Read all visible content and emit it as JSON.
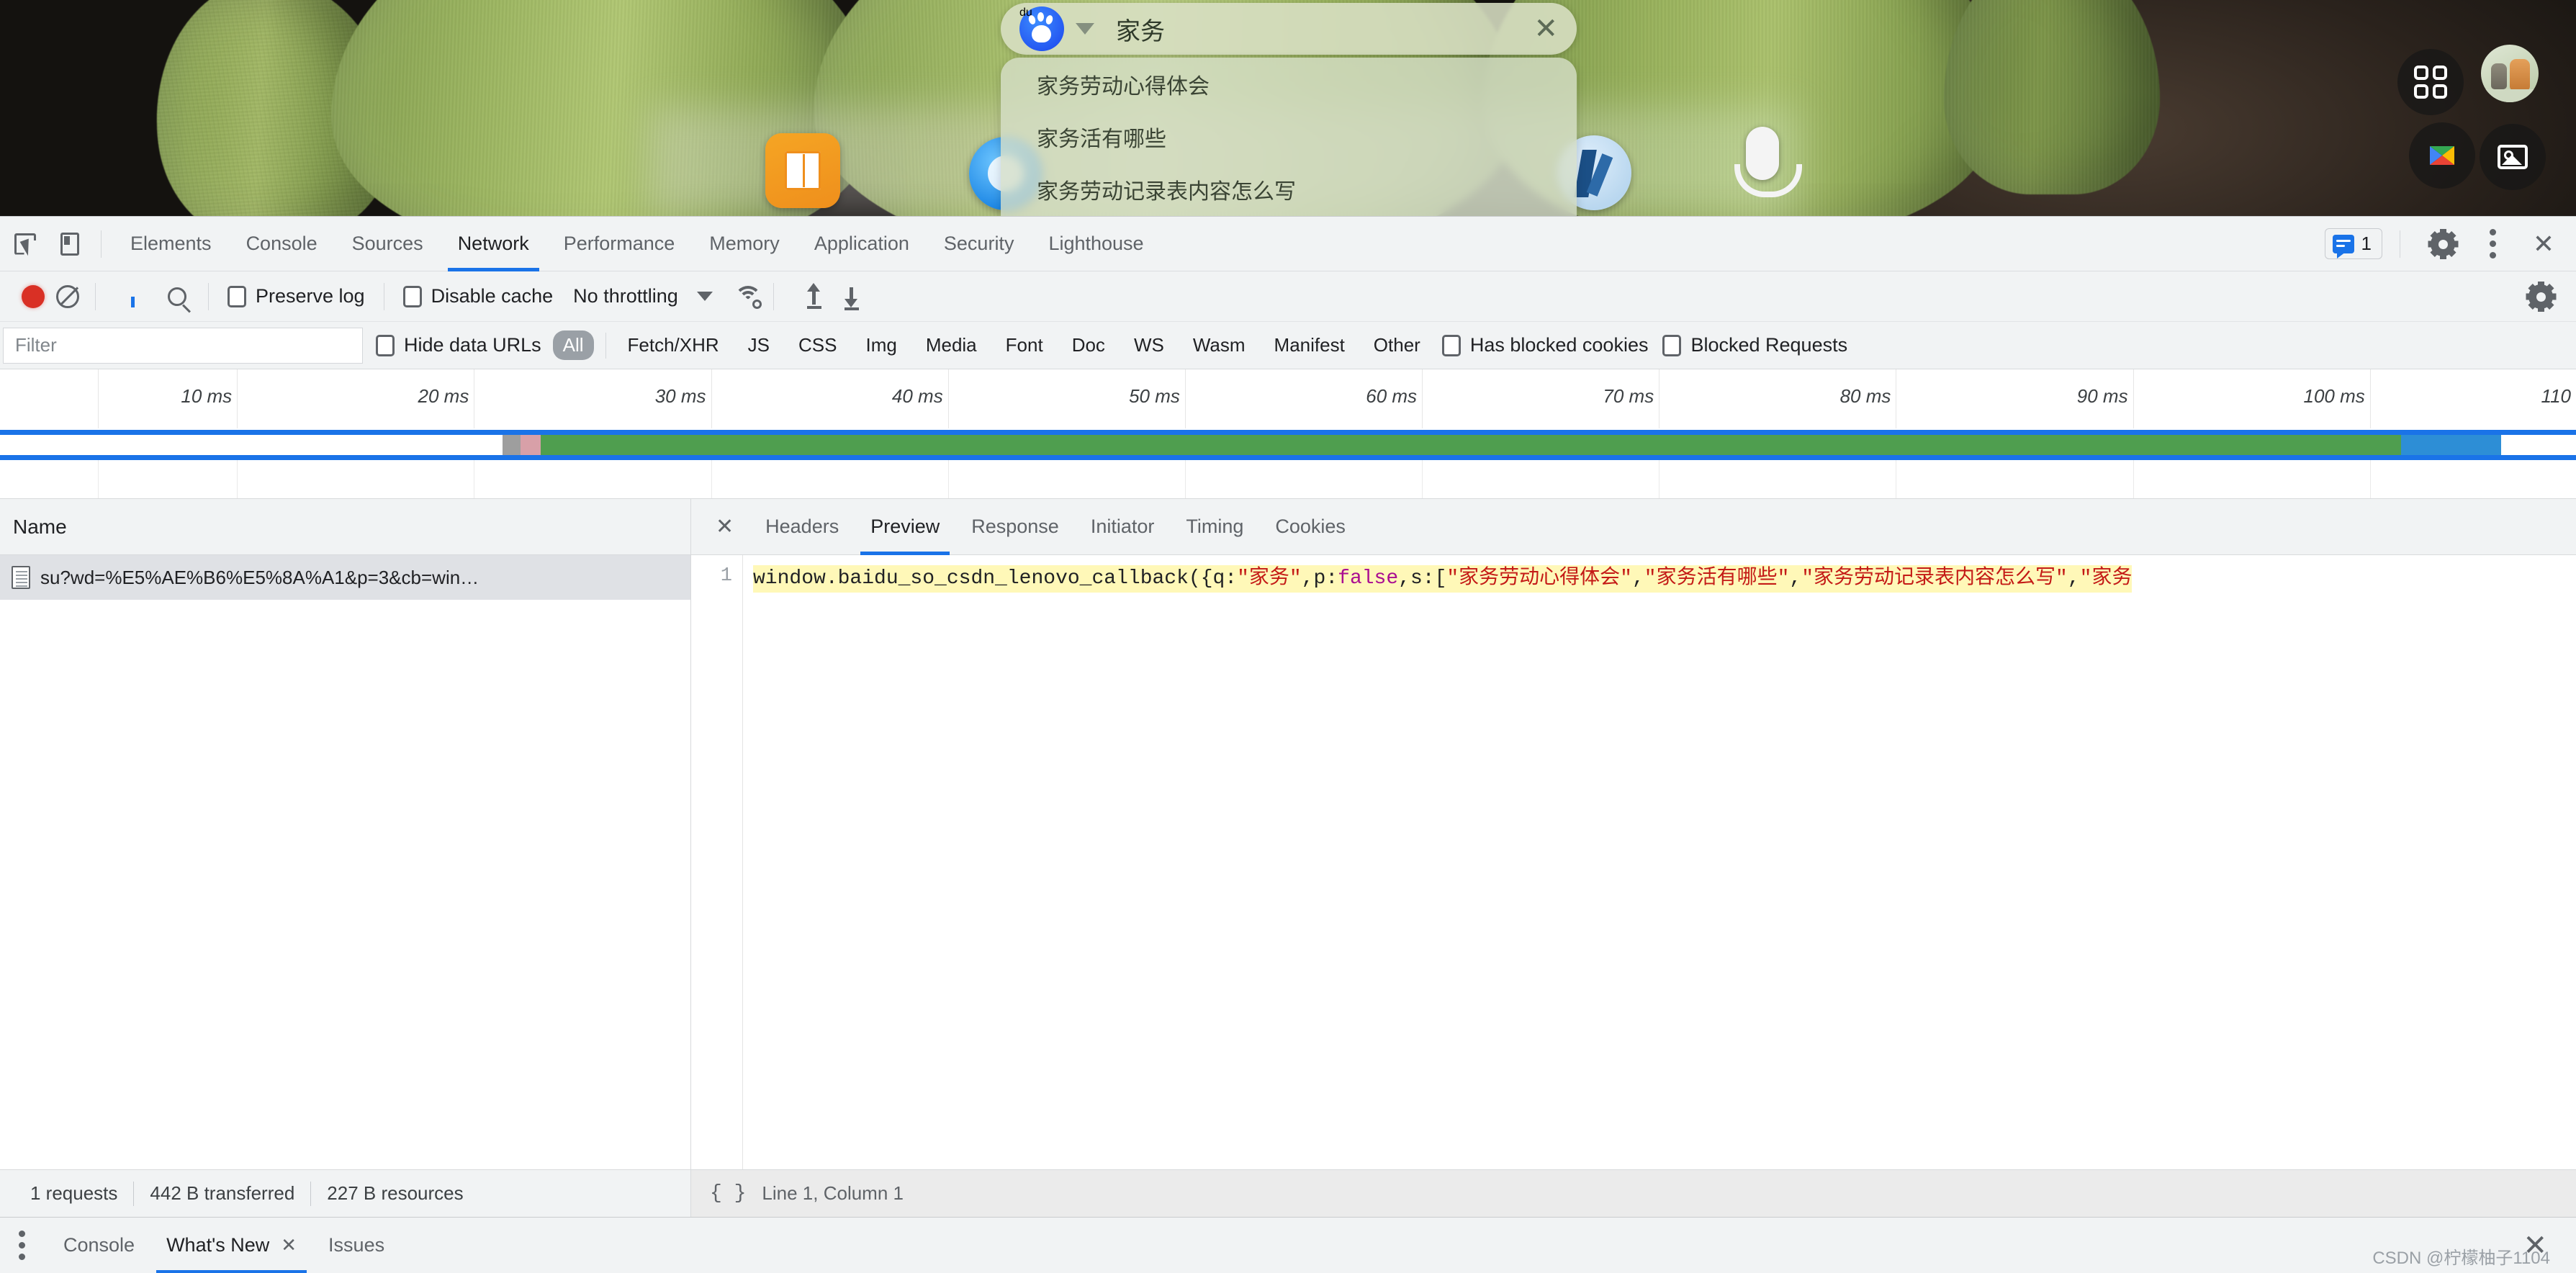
{
  "desktop": {
    "search_widget": {
      "logo": "baidu-paw-logo",
      "query": "家务",
      "clear_label": "✕",
      "suggestions": [
        "家务劳动心得体会",
        "家务活有哪些",
        "家务劳动记录表内容怎么写"
      ]
    },
    "dock": [
      {
        "name": "dock-book-app",
        "label": ""
      },
      {
        "name": "dock-browser-app",
        "label": ""
      },
      {
        "name": "dock-note-app",
        "label": ""
      },
      {
        "name": "dock-mic-app",
        "label": ""
      }
    ],
    "quick_buttons": [
      {
        "name": "apps-grid-button",
        "icon": "grid-icon"
      },
      {
        "name": "account-avatar-button",
        "icon": "avatar"
      },
      {
        "name": "app-store-button",
        "icon": "store-icon"
      },
      {
        "name": "gallery-button",
        "icon": "photo-icon"
      }
    ]
  },
  "devtools": {
    "toolbar_icons": {
      "inspect": "inspect-element-icon",
      "device": "device-toolbar-icon"
    },
    "tabs": [
      {
        "label": "Elements",
        "active": false
      },
      {
        "label": "Console",
        "active": false
      },
      {
        "label": "Sources",
        "active": false
      },
      {
        "label": "Network",
        "active": true
      },
      {
        "label": "Performance",
        "active": false
      },
      {
        "label": "Memory",
        "active": false
      },
      {
        "label": "Application",
        "active": false
      },
      {
        "label": "Security",
        "active": false
      },
      {
        "label": "Lighthouse",
        "active": false
      }
    ],
    "tabbar_right": {
      "message_count": "1",
      "message_icon": "message-icon",
      "settings_icon": "gear-icon",
      "more_icon": "kebab-menu-icon",
      "close_icon": "close-icon"
    },
    "network_toolbar": {
      "record_icon": "record-icon",
      "clear_icon": "clear-icon",
      "filter_icon": "filter-icon",
      "search_icon": "search-icon",
      "preserve_log_label": "Preserve log",
      "preserve_log_checked": false,
      "disable_cache_label": "Disable cache",
      "disable_cache_checked": false,
      "throttling_value": "No throttling",
      "wifi_icon": "network-conditions-icon",
      "import_icon": "import-har-icon",
      "export_icon": "export-har-icon",
      "settings_icon": "gear-icon"
    },
    "filter_bar": {
      "filter_placeholder": "Filter",
      "filter_value": "",
      "hide_data_urls_label": "Hide data URLs",
      "hide_data_urls_checked": false,
      "types": [
        {
          "label": "All",
          "selected": true
        },
        {
          "label": "Fetch/XHR",
          "selected": false
        },
        {
          "label": "JS",
          "selected": false
        },
        {
          "label": "CSS",
          "selected": false
        },
        {
          "label": "Img",
          "selected": false
        },
        {
          "label": "Media",
          "selected": false
        },
        {
          "label": "Font",
          "selected": false
        },
        {
          "label": "Doc",
          "selected": false
        },
        {
          "label": "WS",
          "selected": false
        },
        {
          "label": "Wasm",
          "selected": false
        },
        {
          "label": "Manifest",
          "selected": false
        },
        {
          "label": "Other",
          "selected": false
        }
      ],
      "has_blocked_cookies_label": "Has blocked cookies",
      "has_blocked_cookies_checked": false,
      "blocked_requests_label": "Blocked Requests",
      "blocked_requests_checked": false
    },
    "overview": {
      "tick_labels": [
        "10 ms",
        "20 ms",
        "30 ms",
        "40 ms",
        "50 ms",
        "60 ms",
        "70 ms",
        "80 ms",
        "90 ms",
        "100 ms",
        "110"
      ],
      "bar_segments": [
        {
          "name": "gray",
          "color": "#9e9e9e",
          "start_pct": 19.5,
          "end_pct": 20.2
        },
        {
          "name": "pink",
          "color": "#d8a0a8",
          "start_pct": 20.2,
          "end_pct": 21.0
        },
        {
          "name": "green",
          "color": "#4f9e4f",
          "start_pct": 21.0,
          "end_pct": 93.2
        },
        {
          "name": "lightblue",
          "color": "#2d8ed6",
          "start_pct": 93.2,
          "end_pct": 97.1
        }
      ]
    },
    "request_table": {
      "column_header": "Name",
      "rows": [
        {
          "icon": "document-icon",
          "name": "su?wd=%E5%AE%B6%E5%8A%A1&p=3&cb=win…",
          "selected": true
        }
      ]
    },
    "detail": {
      "close_label": "✕",
      "tabs": [
        {
          "label": "Headers",
          "active": false
        },
        {
          "label": "Preview",
          "active": true
        },
        {
          "label": "Response",
          "active": false
        },
        {
          "label": "Initiator",
          "active": false
        },
        {
          "label": "Timing",
          "active": false
        },
        {
          "label": "Cookies",
          "active": false
        }
      ],
      "line_number": "1",
      "code_tokens": [
        {
          "text": "window.baidu_so_csdn_lenovo_callback({q:",
          "type": "plain"
        },
        {
          "text": "\"家务\"",
          "type": "string"
        },
        {
          "text": ",p:",
          "type": "plain"
        },
        {
          "text": "false",
          "type": "keyword"
        },
        {
          "text": ",s:[",
          "type": "plain"
        },
        {
          "text": "\"家务劳动心得体会\"",
          "type": "string"
        },
        {
          "text": ",",
          "type": "plain"
        },
        {
          "text": "\"家务活有哪些\"",
          "type": "string"
        },
        {
          "text": ",",
          "type": "plain"
        },
        {
          "text": "\"家务劳动记录表内容怎么写\"",
          "type": "string"
        },
        {
          "text": ",",
          "type": "plain"
        },
        {
          "text": "\"家务",
          "type": "string"
        }
      ]
    },
    "status_bar": {
      "requests": "1 requests",
      "transferred": "442 B transferred",
      "resources": "227 B resources",
      "format_icon": "pretty-print-icon",
      "cursor_position": "Line 1, Column 1"
    },
    "drawer": {
      "more_icon": "kebab-menu-icon",
      "tabs": [
        {
          "label": "Console",
          "active": false,
          "closable": false
        },
        {
          "label": "What's New",
          "active": true,
          "closable": true
        },
        {
          "label": "Issues",
          "active": false,
          "closable": false
        }
      ],
      "close_label": "✕"
    }
  },
  "watermark": "CSDN @柠檬柚子1104"
}
